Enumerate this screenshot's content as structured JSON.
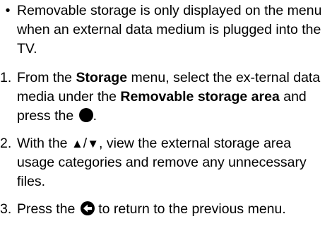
{
  "note": {
    "bullet": "•",
    "text": "Removable storage is only displayed on the menu when an external data medium is plugged into the TV."
  },
  "steps": [
    {
      "number": "1.",
      "text_before": "From the ",
      "bold_1": "Storage",
      "text_middle": " menu, select the ex-ternal data media under the ",
      "bold_2": "Removable storage area",
      "text_after": " and press the ",
      "icon": "ok-dot-icon",
      "text_end": "."
    },
    {
      "number": "2.",
      "text_before": "With the ",
      "icon_up": "▲",
      "separator": "/",
      "icon_down": "▼",
      "text_after": ", view the external storage area usage categories and remove any unnecessary files."
    },
    {
      "number": "3.",
      "text_before": "Press the ",
      "icon": "back-arrow-icon",
      "text_after": " to return to the previous menu."
    }
  ]
}
